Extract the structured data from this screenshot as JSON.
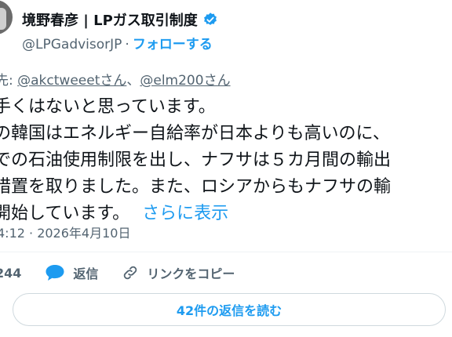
{
  "author": {
    "name": "境野春彦 | LPガス取引制度",
    "handle": "@LPGadvisorJP",
    "separator": "·",
    "follow_label": "フォローする"
  },
  "reply_to": {
    "prefix": "先: ",
    "users": [
      "@akctweeetさん",
      "@elm200さん"
    ],
    "joiner": "、"
  },
  "tweet": {
    "lines": [
      "手くはないと思っています。",
      "の韓国はエネルギー自給率が日本よりも高いのに、",
      "での石油使用制限を出し、ナフサは５カ月間の輸出",
      "措置を取りました。また、ロシアからもナフサの輸",
      "開始しています。"
    ],
    "show_more": "さらに表示",
    "timestamp": "4:12 · 2026年4月10日"
  },
  "actions": {
    "like_count": "244",
    "reply_label": "返信",
    "copy_link_label": "リンクをコピー"
  },
  "read_replies_label": "42件の返信を読む",
  "colors": {
    "accent": "#1d9bf0",
    "muted": "#536471",
    "text": "#0f1419",
    "like": "#1d9bf0"
  }
}
